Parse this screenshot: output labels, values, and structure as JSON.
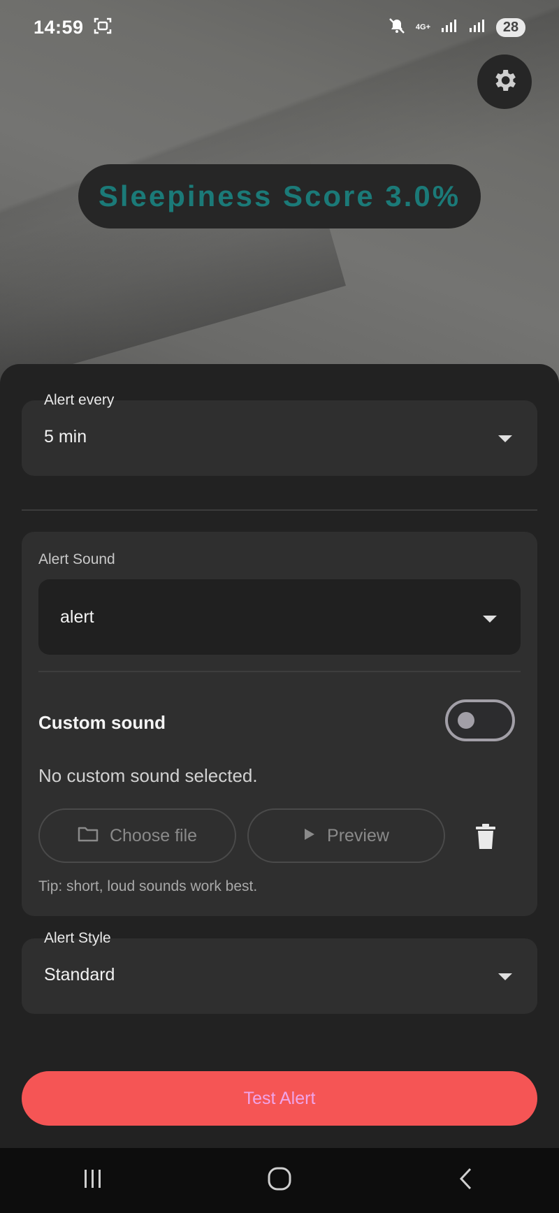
{
  "status_bar": {
    "time": "14:59",
    "network": "4G+",
    "battery": "28"
  },
  "header": {
    "settings_icon": "gear-icon",
    "sleepiness_score": "Sleepiness Score 3.0%"
  },
  "alert_interval": {
    "label": "Alert every",
    "value": "5 min"
  },
  "alert_sound": {
    "label": "Alert Sound",
    "value": "alert",
    "custom_sound_label": "Custom sound",
    "custom_sound_enabled": false,
    "no_custom_text": "No custom sound selected.",
    "choose_file_label": "Choose file",
    "preview_label": "Preview",
    "tip": "Tip: short, loud sounds work best."
  },
  "alert_style": {
    "label": "Alert Style",
    "value": "Standard"
  },
  "test_button": {
    "label": "Test Alert"
  },
  "nav": {
    "recents_icon": "recents-icon",
    "home_icon": "home-icon",
    "back_icon": "back-icon"
  },
  "colors": {
    "accent_score": "#1b7a78",
    "test_button_bg": "#f55555",
    "test_button_text": "#f0a4e8",
    "sheet_bg": "#222222",
    "card_bg": "#2f2f2f"
  }
}
